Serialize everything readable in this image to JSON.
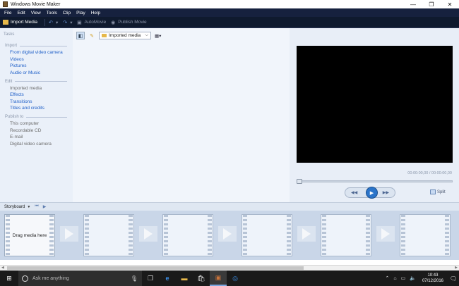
{
  "window": {
    "title": "Windows Movie Maker",
    "minimize": "—",
    "restore": "❐",
    "close": "✕"
  },
  "menu": [
    "File",
    "Edit",
    "View",
    "Tools",
    "Clip",
    "Play",
    "Help"
  ],
  "toolbar": {
    "import_media": "Import Media",
    "undo_icon": "↶",
    "redo_icon": "↷",
    "automovie": "AutoMovie",
    "publish_movie": "Publish Movie"
  },
  "tasks": {
    "title": "Tasks",
    "import": {
      "heading": "Import",
      "items": [
        "From digital video camera",
        "Videos",
        "Pictures",
        "Audio or Music"
      ]
    },
    "edit": {
      "heading": "Edit",
      "items": [
        "Imported media",
        "Effects",
        "Transitions",
        "Titles and credits"
      ]
    },
    "publish": {
      "heading": "Publish to",
      "items": [
        "This computer",
        "Recordable CD",
        "E-mail",
        "Digital video camera"
      ]
    }
  },
  "collection": {
    "selected": "Imported media",
    "view_icon": "▦▾"
  },
  "preview": {
    "timecode": "00:00:00,00 / 00:00:00,00",
    "split_label": "Split",
    "seek_position": 0
  },
  "storyboard": {
    "label": "Storyboard",
    "drag_text": "Drag media here",
    "frame_count": 6
  },
  "taskbar": {
    "search_placeholder": "Ask me anything",
    "time": "10:43",
    "date": "07/12/2016"
  },
  "colors": {
    "menubar": "#16213e",
    "toolbar": "#0f1a2e",
    "link": "#2060c8",
    "play": "#2b74c9",
    "taskbar": "#1a1a1a"
  }
}
